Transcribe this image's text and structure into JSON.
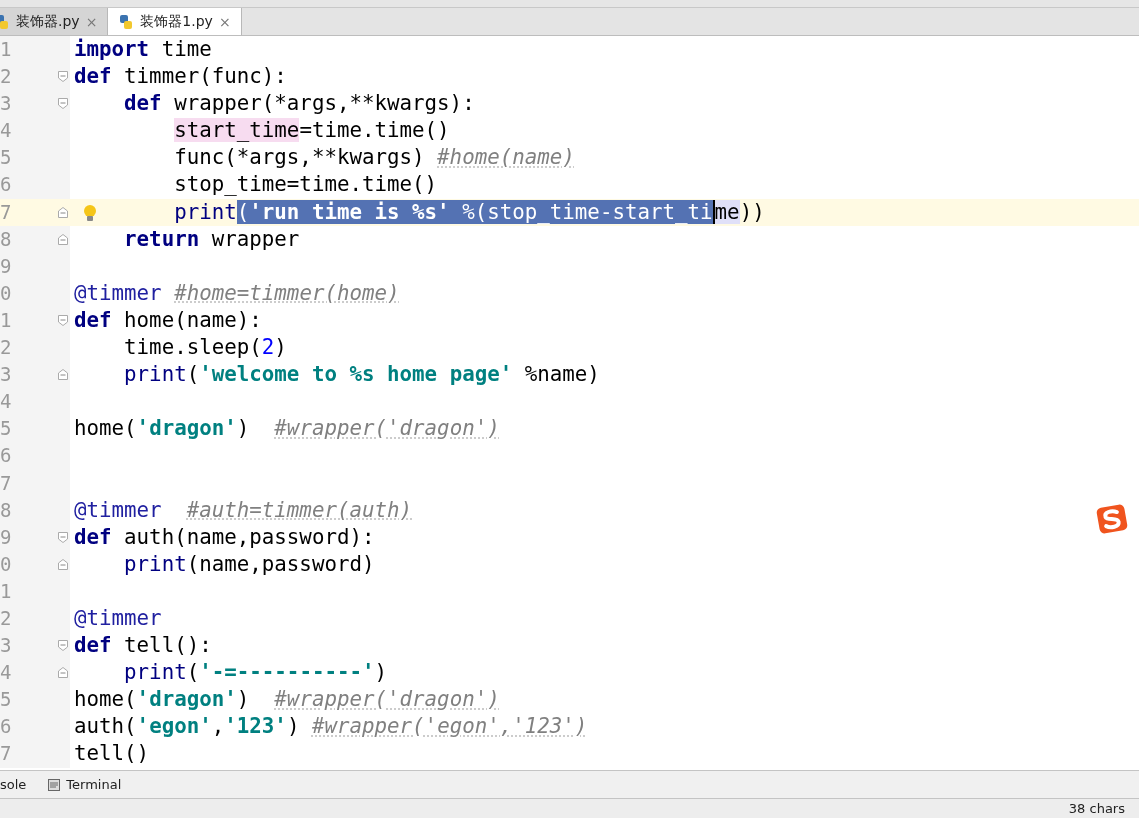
{
  "tabs": [
    {
      "label": "装饰器.py",
      "selected": false,
      "close": "×"
    },
    {
      "label": "装饰器1.py",
      "selected": true,
      "close": "×"
    }
  ],
  "editor": {
    "lines": [
      {
        "number": "1",
        "current": false,
        "bulb": false,
        "tokens": [
          {
            "kind": "keyword",
            "text": "import"
          },
          {
            "kind": "name",
            "text": " time"
          }
        ]
      },
      {
        "number": "2",
        "current": false,
        "bulb": false,
        "fold_start": true,
        "tokens": [
          {
            "kind": "keyword",
            "text": "def"
          },
          {
            "kind": "name",
            "text": " timmer(func):"
          }
        ]
      },
      {
        "number": "3",
        "current": false,
        "bulb": false,
        "fold_start": true,
        "tokens": [
          {
            "kind": "keyword",
            "text": "    def"
          },
          {
            "kind": "name",
            "text": " wrapper(*args,**kwargs):"
          }
        ]
      },
      {
        "number": "4",
        "current": false,
        "bulb": false,
        "tokens": [
          {
            "kind": "name",
            "text": "        start_time",
            "usage_highlight": true
          },
          {
            "kind": "name",
            "text": "=time.time()"
          }
        ]
      },
      {
        "number": "5",
        "current": false,
        "bulb": false,
        "tokens": [
          {
            "kind": "name",
            "text": "        func(*args,**kwargs) "
          },
          {
            "kind": "comment",
            "text": "#home(name)"
          }
        ]
      },
      {
        "number": "6",
        "current": false,
        "bulb": false,
        "tokens": [
          {
            "kind": "name",
            "text": "        stop_time=time.time()"
          }
        ]
      },
      {
        "number": "7",
        "current": true,
        "bulb": true,
        "fold_end": true,
        "tokens": [
          {
            "kind": "builtin",
            "text": "        print",
            "selected": false
          },
          {
            "kind": "name",
            "text": "(",
            "selected": true
          },
          {
            "kind": "string",
            "text": "'run time is %s'",
            "selected": true
          },
          {
            "kind": "name",
            "text": " %(stop_time-start_ti",
            "selected": true
          },
          {
            "kind": "name",
            "text": "me",
            "selected": false,
            "identifier_highlight": true,
            "caret_before": true
          },
          {
            "kind": "name",
            "text": "))",
            "selected": false
          }
        ]
      },
      {
        "number": "8",
        "current": false,
        "bulb": false,
        "fold_end": true,
        "tokens": [
          {
            "kind": "keyword",
            "text": "    return"
          },
          {
            "kind": "name",
            "text": " wrapper"
          }
        ]
      },
      {
        "number": "9",
        "current": false,
        "bulb": false
      },
      {
        "number": "0",
        "current": false,
        "bulb": false,
        "tokens": [
          {
            "kind": "decorator",
            "text": "@timmer "
          },
          {
            "kind": "comment",
            "text": "#home=timmer(home)"
          }
        ]
      },
      {
        "number": "1",
        "current": false,
        "bulb": false,
        "fold_start": true,
        "tokens": [
          {
            "kind": "keyword",
            "text": "def"
          },
          {
            "kind": "name",
            "text": " home(name):"
          }
        ]
      },
      {
        "number": "2",
        "current": false,
        "bulb": false,
        "tokens": [
          {
            "kind": "name",
            "text": "    time.sleep("
          },
          {
            "kind": "number",
            "text": "2"
          },
          {
            "kind": "name",
            "text": ")"
          }
        ]
      },
      {
        "number": "3",
        "current": false,
        "bulb": false,
        "fold_end": true,
        "tokens": [
          {
            "kind": "builtin",
            "text": "    print"
          },
          {
            "kind": "name",
            "text": "("
          },
          {
            "kind": "string",
            "text": "'welcome to %s home page'"
          },
          {
            "kind": "name",
            "text": " %name)"
          }
        ]
      },
      {
        "number": "4",
        "current": false,
        "bulb": false
      },
      {
        "number": "5",
        "current": false,
        "bulb": false,
        "tokens": [
          {
            "kind": "name",
            "text": "home("
          },
          {
            "kind": "string",
            "text": "'dragon'"
          },
          {
            "kind": "name",
            "text": ")  "
          },
          {
            "kind": "comment",
            "text": "#wrapper('dragon')"
          }
        ]
      },
      {
        "number": "6",
        "current": false,
        "bulb": false
      },
      {
        "number": "7",
        "current": false,
        "bulb": false
      },
      {
        "number": "8",
        "current": false,
        "bulb": false,
        "tokens": [
          {
            "kind": "decorator",
            "text": "@timmer  "
          },
          {
            "kind": "comment",
            "text": "#auth=timmer(auth)"
          }
        ]
      },
      {
        "number": "9",
        "current": false,
        "bulb": false,
        "fold_start": true,
        "tokens": [
          {
            "kind": "keyword",
            "text": "def"
          },
          {
            "kind": "name",
            "text": " auth(name,password):"
          }
        ]
      },
      {
        "number": "0",
        "current": false,
        "bulb": false,
        "fold_end": true,
        "tokens": [
          {
            "kind": "builtin",
            "text": "    print"
          },
          {
            "kind": "name",
            "text": "(name,password)"
          }
        ]
      },
      {
        "number": "1",
        "current": false,
        "bulb": false
      },
      {
        "number": "2",
        "current": false,
        "bulb": false,
        "tokens": [
          {
            "kind": "decorator",
            "text": "@timmer"
          }
        ]
      },
      {
        "number": "3",
        "current": false,
        "bulb": false,
        "fold_start": true,
        "tokens": [
          {
            "kind": "keyword",
            "text": "def"
          },
          {
            "kind": "name",
            "text": " tell():"
          }
        ]
      },
      {
        "number": "4",
        "current": false,
        "bulb": false,
        "fold_end": true,
        "tokens": [
          {
            "kind": "builtin",
            "text": "    print"
          },
          {
            "kind": "name",
            "text": "("
          },
          {
            "kind": "string",
            "text": "'-=----------'"
          },
          {
            "kind": "name",
            "text": ")"
          }
        ]
      },
      {
        "number": "5",
        "current": false,
        "bulb": false,
        "tokens": [
          {
            "kind": "name",
            "text": "home("
          },
          {
            "kind": "string",
            "text": "'dragon'"
          },
          {
            "kind": "name",
            "text": ")  "
          },
          {
            "kind": "comment",
            "text": "#wrapper('dragon')"
          }
        ]
      },
      {
        "number": "6",
        "current": false,
        "bulb": false,
        "tokens": [
          {
            "kind": "name",
            "text": "auth("
          },
          {
            "kind": "string",
            "text": "'egon'"
          },
          {
            "kind": "name",
            "text": ","
          },
          {
            "kind": "string",
            "text": "'123'"
          },
          {
            "kind": "name",
            "text": ") "
          },
          {
            "kind": "comment",
            "text": "#wrapper('egon','123')"
          }
        ]
      },
      {
        "number": "7",
        "current": false,
        "bulb": false,
        "tokens": [
          {
            "kind": "name",
            "text": "tell()"
          }
        ]
      }
    ]
  },
  "tool_tabs": [
    "sole",
    "Terminal"
  ],
  "status_bar": {
    "selection": "38 chars"
  }
}
